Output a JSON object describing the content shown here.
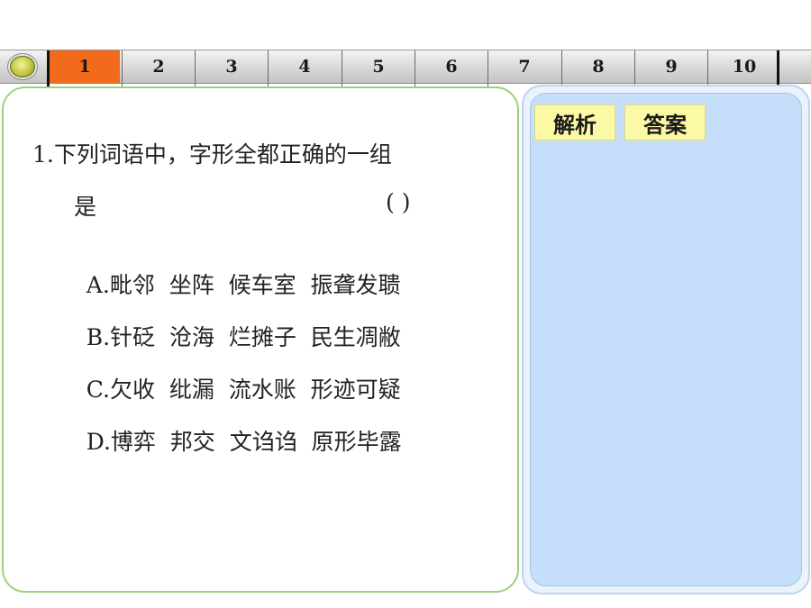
{
  "nav": {
    "tabs": [
      "1",
      "2",
      "3",
      "4",
      "5",
      "6",
      "7",
      "8",
      "9",
      "10"
    ],
    "active_index": 0,
    "active_color": "#f26a1b"
  },
  "question": {
    "stem_line1": "1.下列词语中，字形全都正确的一组",
    "stem_line2": "是",
    "answer_paren": "(     )",
    "options": [
      {
        "label": "A.",
        "words": "毗邻  坐阵  候车室  振聋发聩"
      },
      {
        "label": "B.",
        "words": "针砭  沧海  烂摊子  民生凋敝"
      },
      {
        "label": "C.",
        "words": "欠收  纰漏  流水账  形迹可疑"
      },
      {
        "label": "D.",
        "words": "博弈  邦交  文诌诌  原形毕露"
      }
    ]
  },
  "answer_panel": {
    "explain_label": "解析",
    "answer_label": "答案"
  },
  "colors": {
    "question_border": "#9ad27a",
    "answer_bg": "#c5def9",
    "tab_bg": "#fbf8a6"
  }
}
